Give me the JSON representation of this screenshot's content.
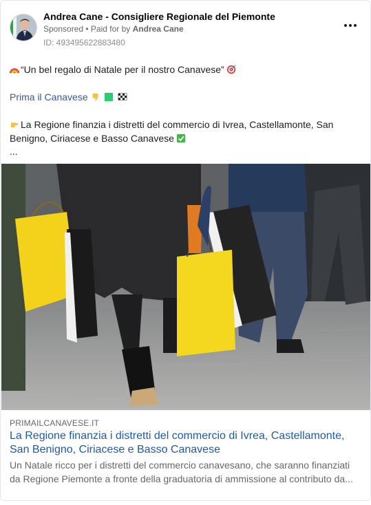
{
  "header": {
    "page_name": "Andrea Cane - Consigliere Regionale del Piemonte",
    "sponsored_label": "Sponsored",
    "paid_for_prefix": " • Paid for by ",
    "paid_for_name": "Andrea Cane",
    "ad_id": "ID: 493495622883480",
    "more_icon": "more-horizontal-icon"
  },
  "post": {
    "line1_text": "“Un bel regalo di Natale per il nostro Canavese”",
    "line1_icons": [
      "rainbow-icon",
      "target-icon"
    ],
    "line2_text": "Prima il Canavese",
    "line2_icons": [
      "pointing-down-hand-icon",
      "green-square-icon",
      "checkered-flag-icon"
    ],
    "line3_text": "La Regione finanzia i distretti del commercio di Ivrea, Castellamonte, San",
    "line4_text": "Benigno, Ciriacese e Basso Canavese",
    "line3_icons": [
      "pointing-right-hand-icon",
      "check-mark-button-icon"
    ],
    "ellipsis": "..."
  },
  "image": {
    "subject": "shoppers carrying shopping bags"
  },
  "link_preview": {
    "domain": "PRIMAILCANAVESE.IT",
    "headline": "La Regione finanzia i distretti del commercio di Ivrea, Castellamonte, San Benigno, Ciriacese e Basso Canavese",
    "description_line1": "Un Natale ricco per i distretti del commercio canavesano, che saranno finanziati",
    "description_line2": "da Regione Piemonte a fronte della graduatoria di ammissione al contributo da..."
  },
  "colors": {
    "link_blue": "#385898",
    "headline_blue": "#1c5ba8",
    "secondary_text": "#65676b",
    "bag_yellow": "#f4d81f"
  }
}
